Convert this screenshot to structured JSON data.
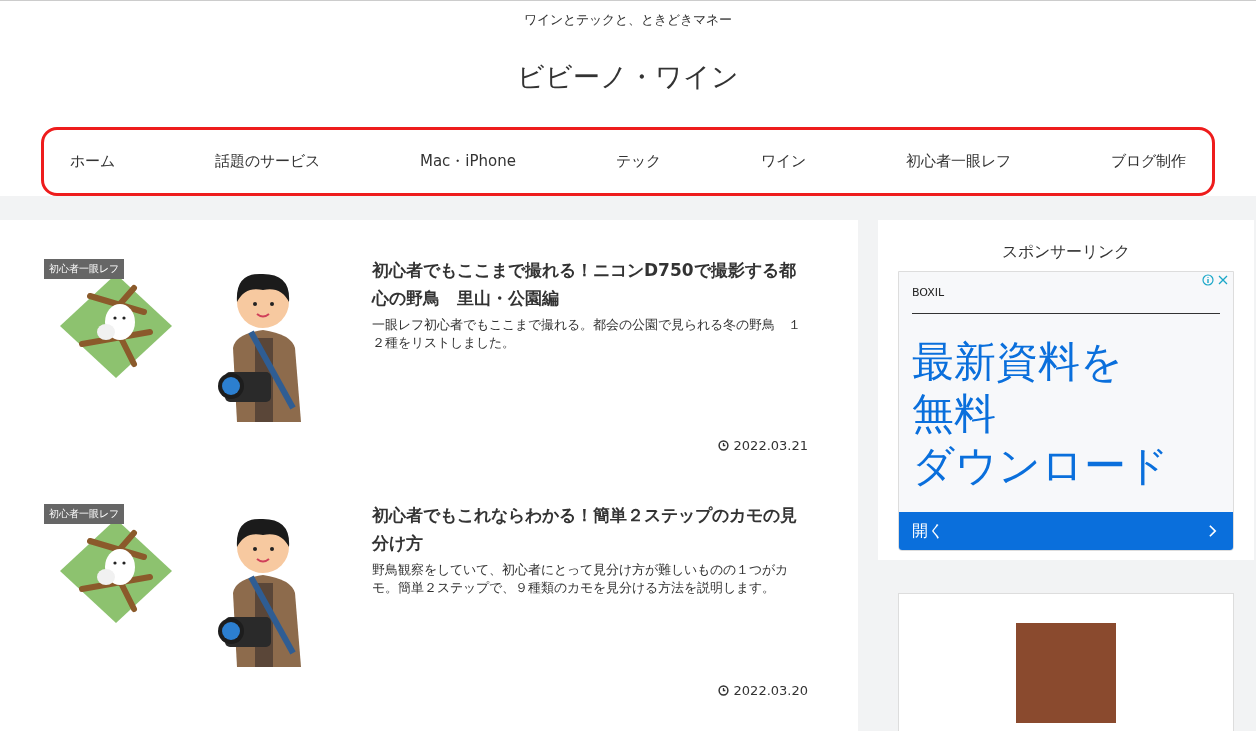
{
  "tagline": "ワインとテックと、ときどきマネー",
  "site_title": "ビビーノ・ワイン",
  "nav": {
    "highlighted": true,
    "items": [
      "ホーム",
      "話題のサービス",
      "Mac・iPhone",
      "テック",
      "ワイン",
      "初心者一眼レフ",
      "ブログ制作"
    ]
  },
  "articles": [
    {
      "category": "初心者一眼レフ",
      "title": "初心者でもここまで撮れる！ニコンD750で撮影する都心の野鳥　里山・公園編",
      "excerpt": "一眼レフ初心者でもここまで撮れる。都会の公園で見られる冬の野鳥　１２種をリストしました。",
      "date": "2022.03.21"
    },
    {
      "category": "初心者一眼レフ",
      "title": "初心者でもこれならわかる！簡単２ステップのカモの見分け方",
      "excerpt": "野鳥観察をしていて、初心者にとって見分け方が難しいものの１つがカモ。簡単２ステップで、９種類のカモを見分ける方法を説明します。",
      "date": "2022.03.20"
    }
  ],
  "sidebar": {
    "heading": "スポンサーリンク",
    "ad": {
      "advertiser": "BOXIL",
      "headline_lines": [
        "最新資料を",
        "無料",
        "ダウンロード"
      ],
      "button": "開く"
    }
  }
}
